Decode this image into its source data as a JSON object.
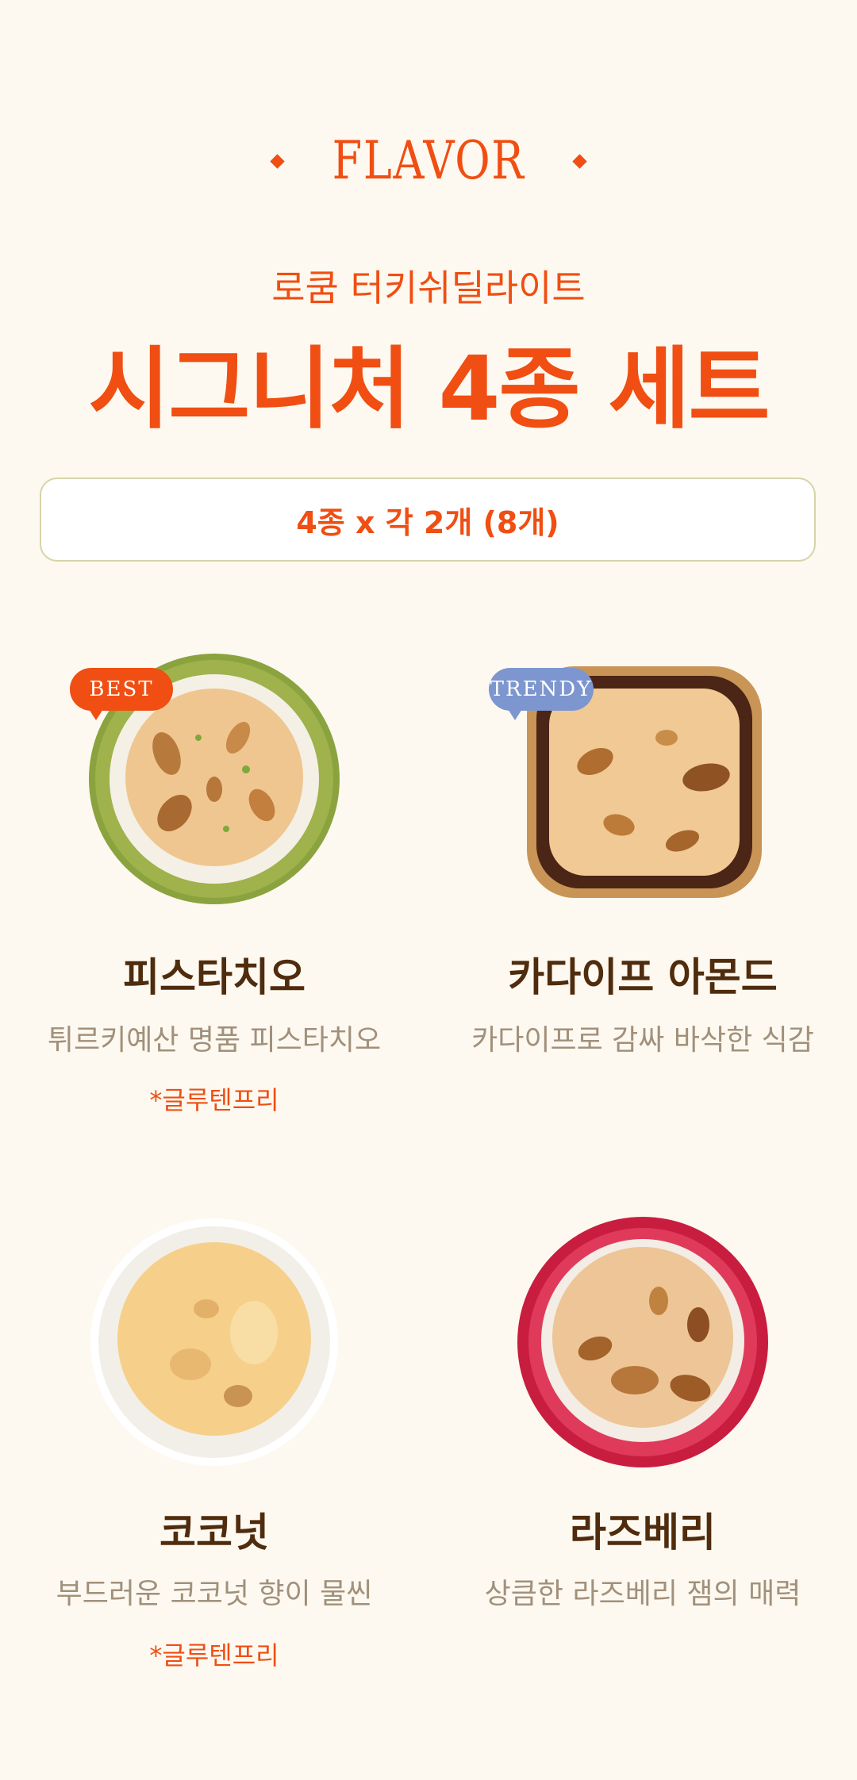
{
  "header": {
    "flavor_label": "FLAVOR",
    "subtitle": "로쿰 터키쉬딜라이트",
    "title": "시그니처 4종 세트",
    "set_info": "4종 x 각 2개 (8개)"
  },
  "products": [
    {
      "name": "피스타치오",
      "description": "튀르키예산 명품 피스타치오",
      "note": "*글루텐프리",
      "badge": "BEST",
      "coating": "pistachio"
    },
    {
      "name": "카다이프 아몬드",
      "description": "카다이프로 감싸 바삭한 식감",
      "badge": "TRENDY",
      "coating": "chocolate-kadaif"
    },
    {
      "name": "코코넛",
      "description": "부드러운 코코넛 향이 물씬",
      "note": "*글루텐프리",
      "coating": "coconut"
    },
    {
      "name": "라즈베리",
      "description": "상큼한 라즈베리 잼의 매력",
      "coating": "raspberry"
    }
  ],
  "colors": {
    "background": "#fdf9f0",
    "accent": "#f04e12",
    "title_brown": "#4f2c0d",
    "desc_gray": "#a1907b",
    "badge_best": "#f04e12",
    "badge_trendy": "#7d96cf",
    "box_border": "#d6d4a8"
  }
}
